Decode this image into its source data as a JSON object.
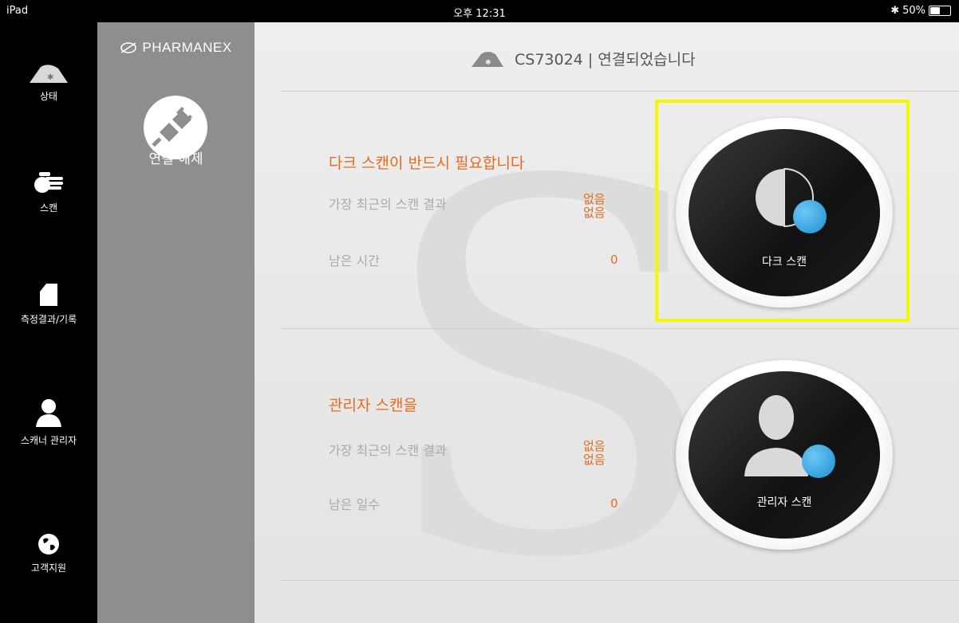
{
  "status_bar": {
    "device": "iPad",
    "time": "오후 12:31",
    "battery": "50%",
    "battery_level": 0.5
  },
  "nav": {
    "items": [
      {
        "label": "상태",
        "icon": "bluetooth-scanner-icon"
      },
      {
        "label": "스캔",
        "icon": "hand-scan-icon"
      },
      {
        "label": "측정결과/기록",
        "icon": "document-icon"
      },
      {
        "label": "스캐너 관리자",
        "icon": "person-icon"
      },
      {
        "label": "고객지원",
        "icon": "globe-icon"
      }
    ]
  },
  "sidebar": {
    "logo": "PHARMANEX",
    "disconnect_label": "연결 해제"
  },
  "header": {
    "title": "CS73024 | 연결되었습니다"
  },
  "dark_scan": {
    "title": "다크 스캔이 반드시 필요합니다",
    "recent_label": "가장 최근의 스캔 결과",
    "recent_value_1": "없음",
    "recent_value_2": "없음",
    "remaining_label": "남은 시간",
    "remaining_value": "0",
    "button_label": "다크 스캔"
  },
  "admin_scan": {
    "title": "관리자 스캔을",
    "recent_label": "가장 최근의 스캔 결과",
    "recent_value_1": "없음",
    "recent_value_2": "없음",
    "remaining_label": "남은 일수",
    "remaining_value": "0",
    "button_label": "관리자 스캔"
  },
  "colors": {
    "accent": "#e66a1c",
    "highlight": "#f6f600",
    "blue_dot": "#1c8fd0"
  }
}
